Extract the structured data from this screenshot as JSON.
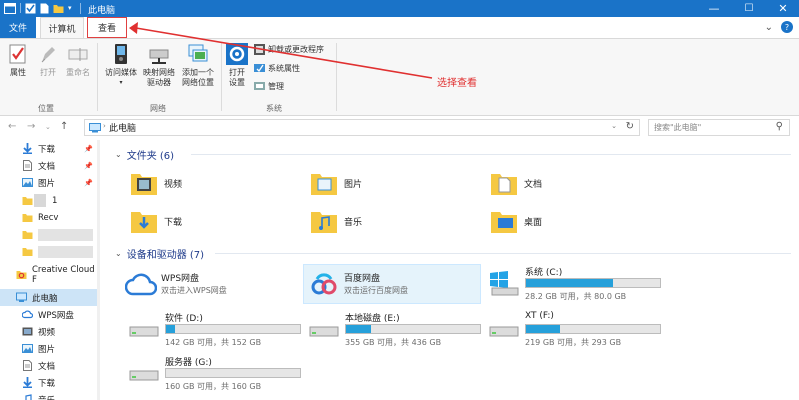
{
  "window": {
    "title": "此电脑",
    "buttons": {
      "minimize": "—",
      "maximize": "☐",
      "close": "✕"
    }
  },
  "tabs": {
    "file": "文件",
    "computer": "计算机",
    "view": "查看"
  },
  "ribbon": {
    "location": {
      "group": "位置",
      "properties": "属性",
      "open": "打开",
      "rename": "重命名"
    },
    "network": {
      "group": "网络",
      "access_media": "访问媒体",
      "map_drive_1": "映射网络",
      "map_drive_2": "驱动器",
      "add_location_1": "添加一个",
      "add_location_2": "网络位置"
    },
    "system": {
      "group": "系统",
      "open_settings_1": "打开",
      "open_settings_2": "设置",
      "uninstall": "卸载或更改程序",
      "system_properties": "系统属性",
      "manage": "管理"
    }
  },
  "annotation": "选择查看",
  "address": {
    "path": "此电脑",
    "search_placeholder": "搜索\"此电脑\""
  },
  "nav": {
    "items": [
      {
        "label": "下载",
        "icon": "download-arrow-icon"
      },
      {
        "label": "文档",
        "icon": "document-icon"
      },
      {
        "label": "图片",
        "icon": "picture-icon"
      },
      {
        "label": "1",
        "icon": "folder-icon"
      },
      {
        "label": "Recv",
        "icon": "folder-icon"
      },
      {
        "label": "Creative Cloud F",
        "icon": "creative-cloud-icon"
      },
      {
        "label": "此电脑",
        "icon": "computer-icon"
      },
      {
        "label": "WPS网盘",
        "icon": "wps-cloud-icon"
      },
      {
        "label": "视频",
        "icon": "video-icon"
      },
      {
        "label": "图片",
        "icon": "picture-icon"
      },
      {
        "label": "文档",
        "icon": "document-icon"
      },
      {
        "label": "下载",
        "icon": "download-arrow-icon"
      },
      {
        "label": "音乐",
        "icon": "music-icon"
      }
    ]
  },
  "folders": {
    "header": "文件夹 (6)",
    "items": [
      "视频",
      "图片",
      "文档",
      "下载",
      "音乐",
      "桌面"
    ]
  },
  "devices": {
    "header": "设备和驱动器 (7)",
    "clouds": [
      {
        "name": "WPS网盘",
        "desc": "双击进入WPS网盘"
      },
      {
        "name": "百度网盘",
        "desc": "双击运行百度网盘"
      }
    ],
    "drives": [
      {
        "name": "系统 (C:)",
        "info": "28.2 GB 可用，共 80.0 GB",
        "used": 0.65
      },
      {
        "name": "软件 (D:)",
        "info": "142 GB 可用，共 152 GB",
        "used": 0.07
      },
      {
        "name": "本地磁盘 (E:)",
        "info": "355 GB 可用，共 436 GB",
        "used": 0.19
      },
      {
        "name": "XT (F:)",
        "info": "219 GB 可用，共 293 GB",
        "used": 0.25
      },
      {
        "name": "服务器 (G:)",
        "info": "160 GB 可用，共 160 GB",
        "used": 0.0
      }
    ]
  },
  "colors": {
    "accent": "#1a73c8",
    "drive_fill": "#26a0da",
    "annotation": "#e03030"
  }
}
